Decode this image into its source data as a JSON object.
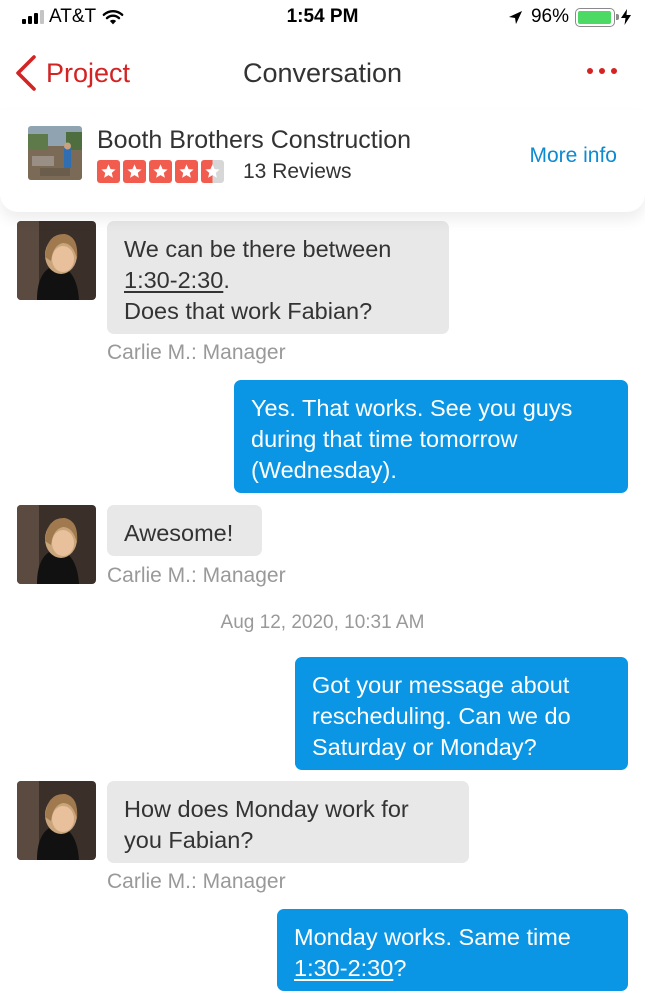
{
  "status_bar": {
    "carrier": "AT&T",
    "time": "1:54 PM",
    "battery_percent": "96%",
    "battery_level": 0.96,
    "battery_color": "#4cd964",
    "icons": [
      "signal-bars-icon",
      "wifi-icon",
      "location-arrow-icon",
      "battery-icon",
      "charging-bolt-icon"
    ]
  },
  "nav": {
    "back_label": "Project",
    "title": "Conversation",
    "back_icon": "chevron-left-icon",
    "menu_icon": "more-dots-icon",
    "accent_color": "#d32323"
  },
  "business": {
    "name": "Booth Brothers Construction",
    "rating": 4.5,
    "reviews": "13 Reviews",
    "more_info": "More info",
    "link_color": "#0d8ad1",
    "star_color": "#f15c4f"
  },
  "messages": [
    {
      "from": "them",
      "lines": [
        {
          "t": "We can be there between"
        },
        {
          "t": "1:30-2:30",
          "u": true,
          "tail": "."
        },
        {
          "t": "Does that work Fabian?"
        }
      ],
      "sender": "Carlie M.: Manager"
    },
    {
      "from": "me",
      "lines": [
        {
          "t": "Yes. That works. See you guys"
        },
        {
          "t": "during that time tomorrow"
        },
        {
          "t": "(Wednesday)."
        }
      ]
    },
    {
      "from": "them",
      "lines": [
        {
          "t": "Awesome!"
        }
      ],
      "sender": "Carlie M.: Manager"
    },
    {
      "from": "me",
      "lines": [
        {
          "t": "Got your message about"
        },
        {
          "t": "rescheduling. Can we do"
        },
        {
          "t": "Saturday or Monday?"
        }
      ]
    },
    {
      "from": "them",
      "lines": [
        {
          "t": "How does Monday work for"
        },
        {
          "t": "you Fabian?"
        }
      ],
      "sender": "Carlie M.: Manager"
    },
    {
      "from": "me",
      "lines": [
        {
          "t": "Monday works. Same time"
        },
        {
          "t": "1:30-2:30",
          "u": true,
          "tail": "?"
        }
      ]
    }
  ],
  "timestamp": "Aug 12, 2020, 10:31 AM",
  "colors": {
    "incoming_bubble": "#e8e8e8",
    "outgoing_bubble": "#0a96e4",
    "meta_text": "#999999"
  }
}
